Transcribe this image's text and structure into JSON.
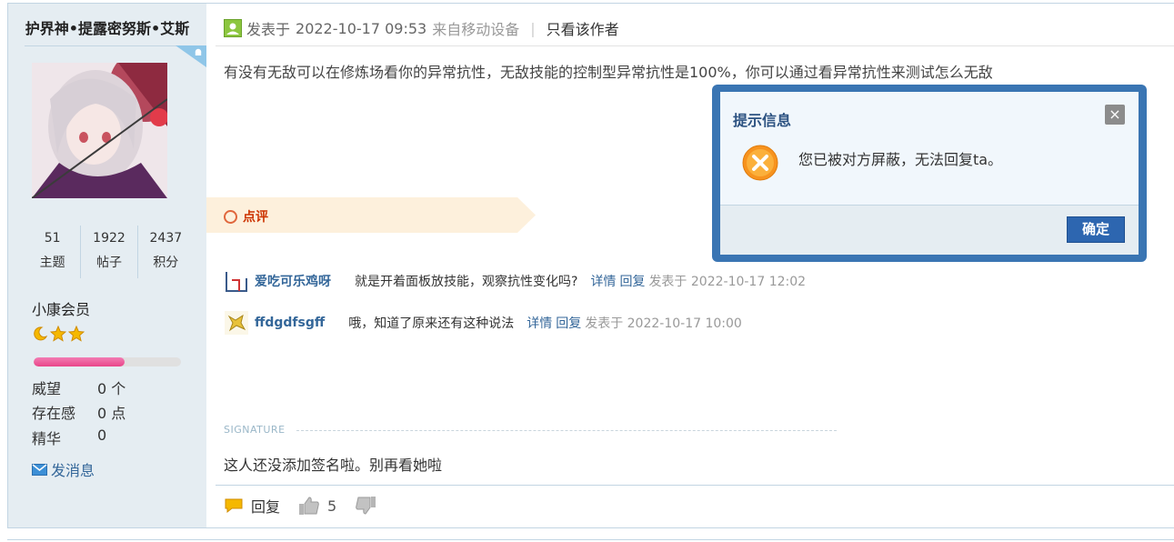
{
  "author": {
    "name": "护界神•提露密努斯•艾斯",
    "stats": [
      {
        "value": "51",
        "label": "主题"
      },
      {
        "value": "1922",
        "label": "帖子"
      },
      {
        "value": "2437",
        "label": "积分"
      }
    ],
    "group": "小康会员",
    "rank_progress_percent": 62,
    "info": [
      {
        "key": "威望",
        "value": "0 个"
      },
      {
        "key": "存在感",
        "value": "0 点"
      },
      {
        "key": "精华",
        "value": "0"
      }
    ],
    "send_message": "发消息"
  },
  "post": {
    "posted_prefix": "发表于",
    "date": "2022-10-17 09:53",
    "source": "来自移动设备",
    "separator": "|",
    "only_author": "只看该作者",
    "body": "有没有无敌可以在修炼场看你的异常抗性，无敌技能的控制型异常抗性是100%，你可以通过看异常抗性来测试怎么无敌"
  },
  "comments_section": {
    "label": "点评",
    "items": [
      {
        "user": "爱吃可乐鸡呀",
        "text": "就是开着面板放技能，观察抗性变化吗?",
        "detail": "详情",
        "reply": "回复",
        "time": "发表于 2022-10-17 12:02"
      },
      {
        "user": "ffdgdfsgff",
        "text": "哦，知道了原来还有这种说法",
        "detail": "详情",
        "reply": "回复",
        "time": "发表于 2022-10-17 10:00"
      }
    ]
  },
  "signature": {
    "label": "SIGNATURE",
    "text": "这人还没添加签名啦。别再看她啦"
  },
  "actions": {
    "reply": "回复",
    "like_count": "5"
  },
  "dialog": {
    "title": "提示信息",
    "message": "您已被对方屏蔽，无法回复ta。",
    "ok": "确定",
    "close": "×"
  },
  "colors": {
    "link": "#336699",
    "sidebar_bg": "#e5edf2",
    "dialog_border": "#3a75b3",
    "ok_button": "#2d66b0",
    "banner": "#fdf0dc"
  }
}
